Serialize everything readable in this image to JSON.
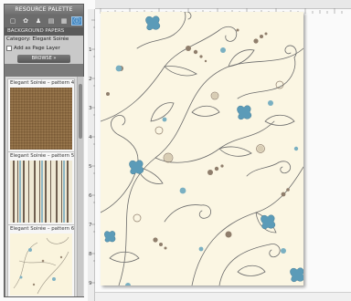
{
  "palette": {
    "title": "RESOURCE PALETTE",
    "section": "BACKGROUND PAPERS",
    "category_label": "Category: Elegant Soirée",
    "add_as_page_layer": "Add as Page Layer",
    "browse_label": "BROWSE",
    "browse_arrow": "»",
    "toolbar_icons": [
      "frame-icon",
      "shape-icon",
      "character-icon",
      "background-icon",
      "embellishment-icon",
      "info-icon"
    ],
    "patterns": [
      {
        "name": "Elegant Soirée – pattern 4"
      },
      {
        "name": "Elegant Soirée – pattern 5"
      },
      {
        "name": "Elegant Soirée – pattern 6"
      }
    ]
  },
  "rulers": {
    "vertical": [
      "1",
      "2",
      "3",
      "4",
      "5",
      "6",
      "7",
      "8",
      "9"
    ]
  },
  "colors": {
    "paper": "#fbf6e3",
    "line": "#6b6b6b",
    "blue_flower": "#5b9bb8",
    "dot_brown": "#8f7e6c",
    "dot_blue": "#7ab0c2"
  }
}
